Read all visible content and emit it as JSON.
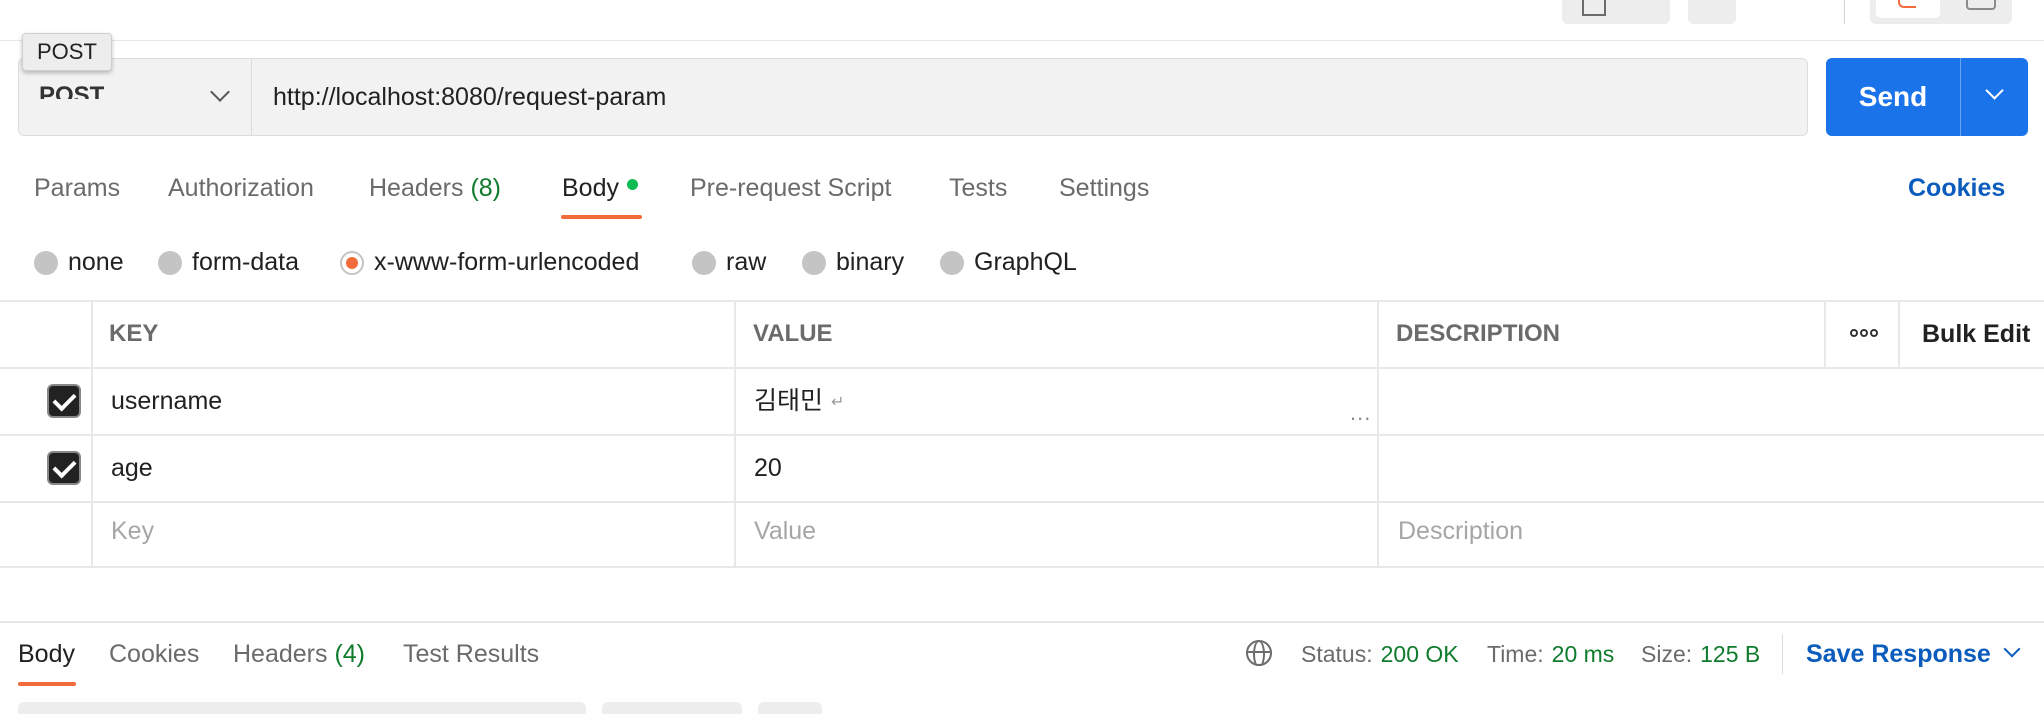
{
  "request": {
    "method": "POST",
    "method_tooltip": "POST",
    "url": "http://localhost:8080/request-param",
    "send_label": "Send"
  },
  "request_tabs": [
    {
      "label": "Params"
    },
    {
      "label": "Authorization"
    },
    {
      "label": "Headers",
      "count": "(8)"
    },
    {
      "label": "Body"
    },
    {
      "label": "Pre-request Script"
    },
    {
      "label": "Tests"
    },
    {
      "label": "Settings"
    }
  ],
  "cookies_label": "Cookies",
  "body_types": [
    "none",
    "form-data",
    "x-www-form-urlencoded",
    "raw",
    "binary",
    "GraphQL"
  ],
  "selected_body_type": "x-www-form-urlencoded",
  "table": {
    "headers": {
      "key": "KEY",
      "value": "VALUE",
      "description": "DESCRIPTION"
    },
    "bulk_edit": "Bulk Edit",
    "rows": [
      {
        "key": "username",
        "value": "김태민",
        "checked": true
      },
      {
        "key": "age",
        "value": "20",
        "checked": true
      }
    ],
    "placeholders": {
      "key": "Key",
      "value": "Value",
      "description": "Description"
    },
    "more_symbol": "..."
  },
  "response": {
    "tabs": [
      {
        "label": "Body"
      },
      {
        "label": "Cookies"
      },
      {
        "label": "Headers",
        "count": "(4)"
      },
      {
        "label": "Test Results"
      }
    ],
    "status_label": "Status:",
    "status_value": "200 OK",
    "time_label": "Time:",
    "time_value": "20 ms",
    "size_label": "Size:",
    "size_value": "125 B",
    "save_label": "Save Response"
  },
  "colors": {
    "accent": "#f26b3a",
    "send": "#1a73e8",
    "link": "#0b5cbd",
    "success": "#0f7b2d"
  }
}
